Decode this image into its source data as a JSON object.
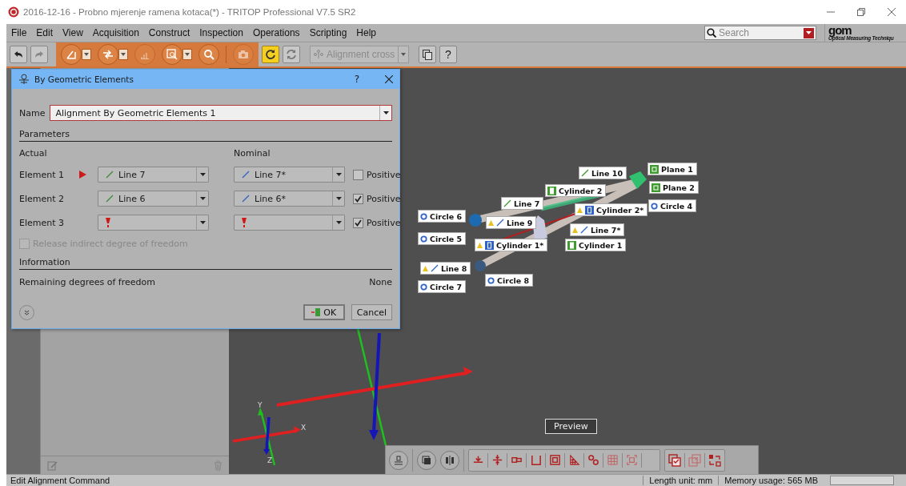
{
  "window": {
    "title": "2016-12-16 - Probno mjerenje ramena kotaca(*) - TRITOP Professional V7.5 SR2"
  },
  "menu": [
    "File",
    "Edit",
    "View",
    "Acquisition",
    "Construct",
    "Inspection",
    "Operations",
    "Scripting",
    "Help"
  ],
  "search": {
    "placeholder": "Search"
  },
  "logo": {
    "mark": "gom",
    "tagline": "Optical Measuring Techniqu"
  },
  "toolbar": {
    "alignment_combo": {
      "text": "Alignment cross",
      "disabled": true
    },
    "help_button": "?"
  },
  "dialog": {
    "title": "By Geometric Elements",
    "help": "?",
    "name_label": "Name",
    "name_value": "Alignment By Geometric Elements 1",
    "parameters_heading": "Parameters",
    "actual_heading": "Actual",
    "nominal_heading": "Nominal",
    "elements": [
      {
        "label": "Element 1",
        "current": true,
        "actual": {
          "kind": "line",
          "text": "Line 7"
        },
        "nominal": {
          "kind": "line",
          "text": "Line 7*"
        },
        "positive": {
          "label": "Positive",
          "checked": false
        }
      },
      {
        "label": "Element 2",
        "current": false,
        "actual": {
          "kind": "line",
          "text": "Line 6"
        },
        "nominal": {
          "kind": "line",
          "text": "Line 6*"
        },
        "positive": {
          "label": "Positive",
          "checked": true
        }
      },
      {
        "label": "Element 3",
        "current": false,
        "actual": {
          "kind": "missing"
        },
        "nominal": {
          "kind": "missing"
        },
        "positive": {
          "label": "Positive",
          "checked": true
        }
      }
    ],
    "release": {
      "label": "Release indirect degree of freedom",
      "checked": false,
      "disabled": true
    },
    "information_heading": "Information",
    "remaining_label": "Remaining degrees of freedom",
    "remaining_value": "None",
    "buttons": [
      {
        "kind": "ok",
        "label": "OK"
      },
      {
        "kind": "cancel",
        "label": "Cancel"
      }
    ]
  },
  "viewport": {
    "labels": [
      {
        "text": "Plane 1",
        "kind": "plane",
        "nominal": false
      },
      {
        "text": "Line 10",
        "kind": "line",
        "nominal": false
      },
      {
        "text": "Cylinder 2",
        "kind": "cylinder",
        "nominal": false
      },
      {
        "text": "Plane 2",
        "kind": "plane",
        "nominal": false
      },
      {
        "text": "Line 7",
        "kind": "line",
        "nominal": false
      },
      {
        "text": "Cylinder 2*",
        "kind": "cylinder",
        "nominal": true
      },
      {
        "text": "Circle 4",
        "kind": "circle",
        "nominal": false
      },
      {
        "text": "Circle 6",
        "kind": "circle",
        "nominal": false
      },
      {
        "text": "Line 9",
        "kind": "line",
        "nominal": true
      },
      {
        "text": "Line 7*",
        "kind": "line",
        "nominal": true
      },
      {
        "text": "Circle 5",
        "kind": "circle",
        "nominal": false
      },
      {
        "text": "Cylinder 1*",
        "kind": "cylinder",
        "nominal": true
      },
      {
        "text": "Cylinder 1",
        "kind": "cylinder",
        "nominal": false
      },
      {
        "text": "Line 8",
        "kind": "line",
        "nominal": true
      },
      {
        "text": "Circle 8",
        "kind": "circle",
        "nominal": false
      },
      {
        "text": "Circle 7",
        "kind": "circle",
        "nominal": false
      }
    ],
    "triad_labels": [
      "Y",
      "X",
      "Z"
    ],
    "preview_button": "Preview"
  },
  "status_bar": {
    "message": "Edit Alignment Command",
    "length_unit": "Length unit: mm",
    "memory": "Memory usage: 565 MB"
  }
}
